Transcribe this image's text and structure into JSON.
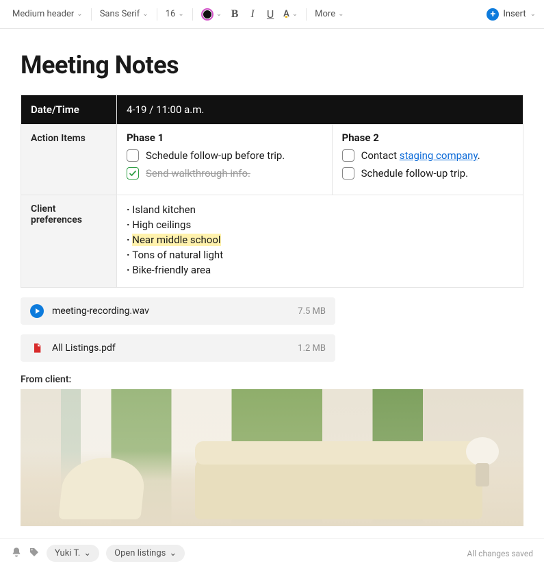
{
  "toolbar": {
    "style_label": "Medium header",
    "font_label": "Sans Serif",
    "size_label": "16",
    "more_label": "More",
    "insert_label": "Insert"
  },
  "page": {
    "title": "Meeting Notes"
  },
  "table": {
    "datetime_label": "Date/Time",
    "datetime_value": "4-19 / 11:00 a.m.",
    "action_items_label": "Action Items",
    "client_prefs_label": "Client preferences",
    "phase1": {
      "title": "Phase 1",
      "items": [
        {
          "text": "Schedule follow-up before trip.",
          "checked": false,
          "strike": false
        },
        {
          "text": "Send walkthrough info.",
          "checked": true,
          "strike": true
        }
      ]
    },
    "phase2": {
      "title": "Phase 2",
      "items": [
        {
          "prefix": "Contact ",
          "link": "staging company",
          "suffix": ".",
          "checked": false
        },
        {
          "text": "Schedule follow-up trip.",
          "checked": false
        }
      ]
    },
    "prefs": [
      {
        "text": "Island kitchen"
      },
      {
        "text": "High ceilings"
      },
      {
        "text": "Near middle school",
        "highlight": true
      },
      {
        "text": "Tons of natural light"
      },
      {
        "text": "Bike-friendly area"
      }
    ]
  },
  "attachments": [
    {
      "icon": "play",
      "name": "meeting-recording.wav",
      "size": "7.5 MB"
    },
    {
      "icon": "pdf",
      "name": "All Listings.pdf",
      "size": "1.2 MB"
    }
  ],
  "from_client_label": "From client:",
  "footer": {
    "user": "Yuki T.",
    "listings_label": "Open listings",
    "status": "All changes saved"
  }
}
